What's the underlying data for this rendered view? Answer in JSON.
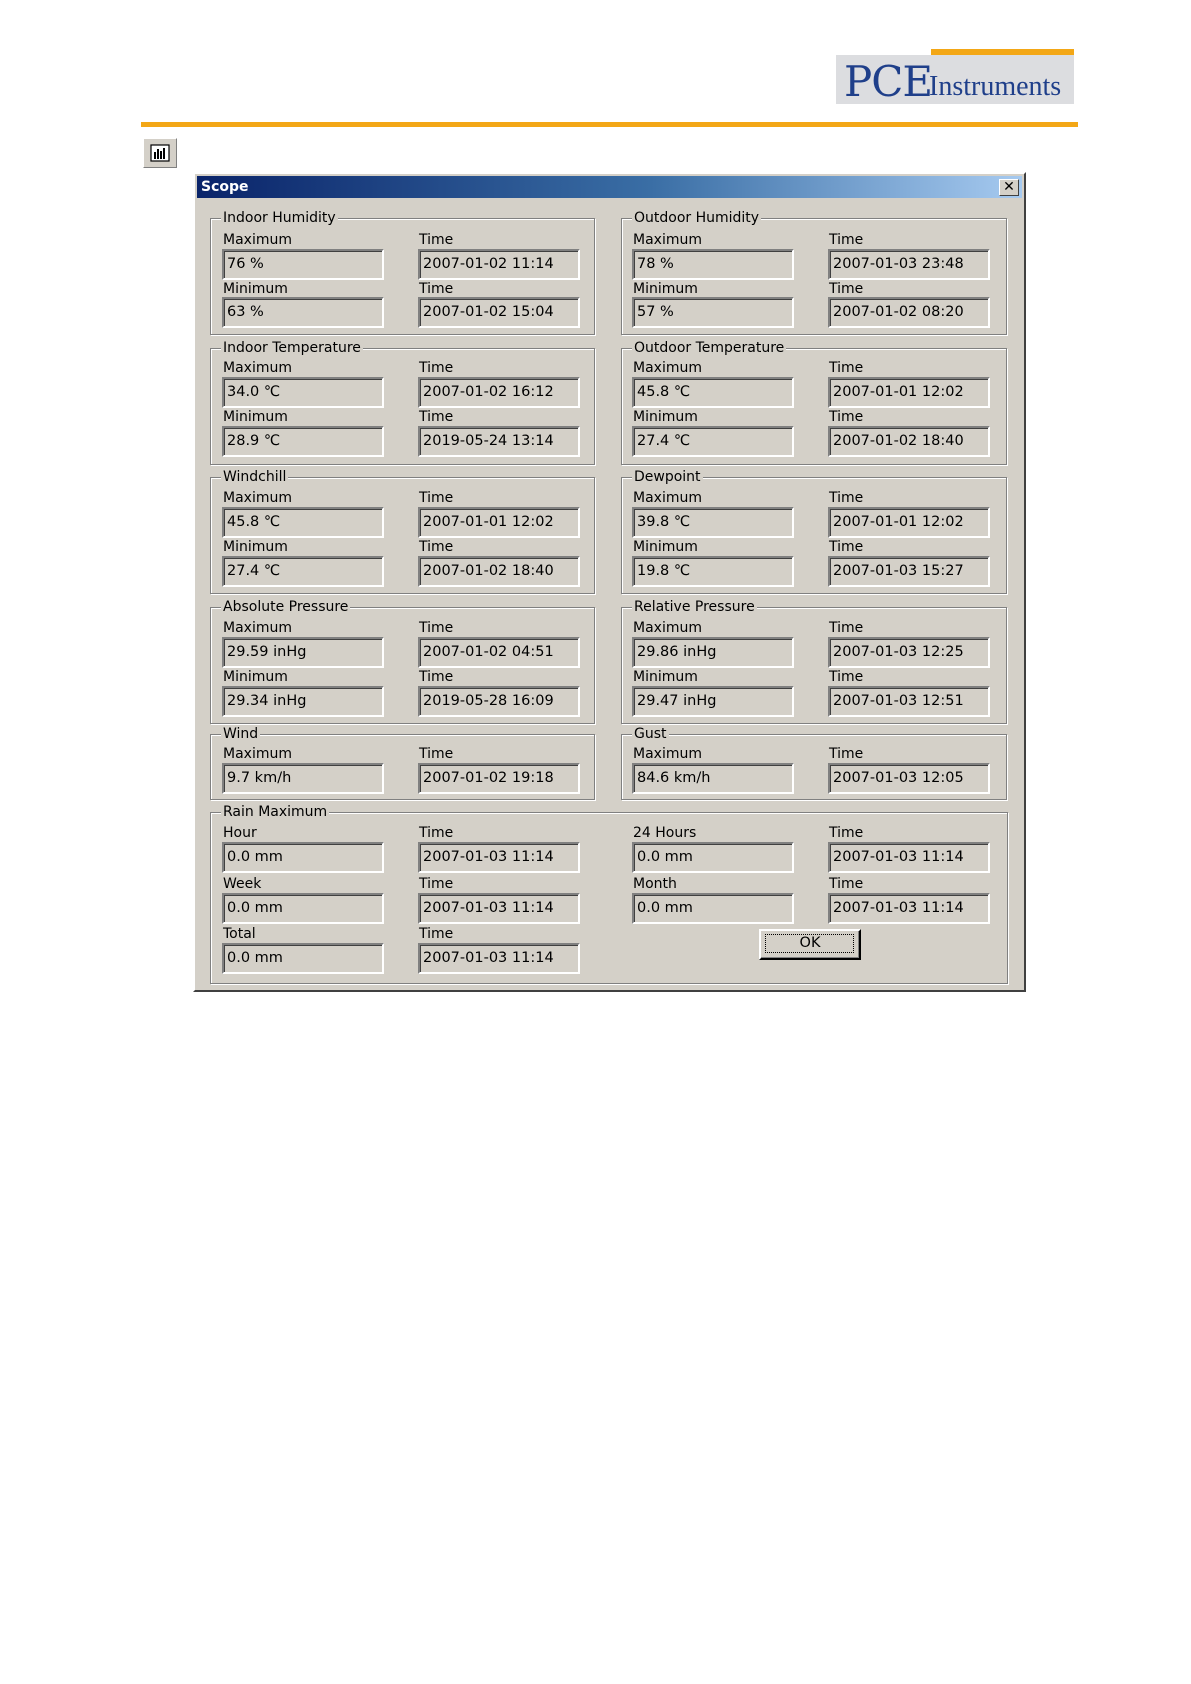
{
  "brand": {
    "logo_text_pce": "PCE",
    "logo_text_instruments": "Instruments",
    "accent_color": "#f3a716",
    "logo_color": "#1f3f8a"
  },
  "toolbar": {
    "icon": "chart-icon"
  },
  "dialog": {
    "title": "Scope",
    "ok_label": "OK",
    "groups": {
      "indoor_humidity": {
        "title": "Indoor Humidity",
        "max_label": "Maximum",
        "max_value": "76 %",
        "max_time_label": "Time",
        "max_time": "2007-01-02 11:14",
        "min_label": "Minimum",
        "min_value": "63 %",
        "min_time_label": "Time",
        "min_time": "2007-01-02 15:04"
      },
      "outdoor_humidity": {
        "title": "Outdoor Humidity",
        "max_label": "Maximum",
        "max_value": "78 %",
        "max_time_label": "Time",
        "max_time": "2007-01-03 23:48",
        "min_label": "Minimum",
        "min_value": "57 %",
        "min_time_label": "Time",
        "min_time": "2007-01-02 08:20"
      },
      "indoor_temperature": {
        "title": "Indoor Temperature",
        "max_label": "Maximum",
        "max_value": "34.0 ℃",
        "max_time_label": "Time",
        "max_time": "2007-01-02 16:12",
        "min_label": "Minimum",
        "min_value": "28.9 ℃",
        "min_time_label": "Time",
        "min_time": "2019-05-24 13:14"
      },
      "outdoor_temperature": {
        "title": "Outdoor Temperature",
        "max_label": "Maximum",
        "max_value": "45.8 ℃",
        "max_time_label": "Time",
        "max_time": "2007-01-01 12:02",
        "min_label": "Minimum",
        "min_value": "27.4 ℃",
        "min_time_label": "Time",
        "min_time": "2007-01-02 18:40"
      },
      "windchill": {
        "title": "Windchill",
        "max_label": "Maximum",
        "max_value": "45.8 ℃",
        "max_time_label": "Time",
        "max_time": "2007-01-01 12:02",
        "min_label": "Minimum",
        "min_value": "27.4 ℃",
        "min_time_label": "Time",
        "min_time": "2007-01-02 18:40"
      },
      "dewpoint": {
        "title": "Dewpoint",
        "max_label": "Maximum",
        "max_value": "39.8 ℃",
        "max_time_label": "Time",
        "max_time": "2007-01-01 12:02",
        "min_label": "Minimum",
        "min_value": "19.8 ℃",
        "min_time_label": "Time",
        "min_time": "2007-01-03 15:27"
      },
      "absolute_pressure": {
        "title": "Absolute Pressure",
        "max_label": "Maximum",
        "max_value": "29.59 inHg",
        "max_time_label": "Time",
        "max_time": "2007-01-02 04:51",
        "min_label": "Minimum",
        "min_value": "29.34 inHg",
        "min_time_label": "Time",
        "min_time": "2019-05-28 16:09"
      },
      "relative_pressure": {
        "title": "Relative Pressure",
        "max_label": "Maximum",
        "max_value": "29.86 inHg",
        "max_time_label": "Time",
        "max_time": "2007-01-03 12:25",
        "min_label": "Minimum",
        "min_value": "29.47 inHg",
        "min_time_label": "Time",
        "min_time": "2007-01-03 12:51"
      },
      "wind": {
        "title": "Wind",
        "max_label": "Maximum",
        "max_value": "9.7 km/h",
        "max_time_label": "Time",
        "max_time": "2007-01-02 19:18"
      },
      "gust": {
        "title": "Gust",
        "max_label": "Maximum",
        "max_value": "84.6 km/h",
        "max_time_label": "Time",
        "max_time": "2007-01-03 12:05"
      },
      "rain": {
        "title": "Rain Maximum",
        "hour_label": "Hour",
        "hour_value": "0.0 mm",
        "hour_time_label": "Time",
        "hour_time": "2007-01-03 11:14",
        "day_label": "24 Hours",
        "day_value": "0.0 mm",
        "day_time_label": "Time",
        "day_time": "2007-01-03 11:14",
        "week_label": "Week",
        "week_value": "0.0 mm",
        "week_time_label": "Time",
        "week_time": "2007-01-03 11:14",
        "month_label": "Month",
        "month_value": "0.0 mm",
        "month_time_label": "Time",
        "month_time": "2007-01-03 11:14",
        "total_label": "Total",
        "total_value": "0.0 mm",
        "total_time_label": "Time",
        "total_time": "2007-01-03 11:14"
      }
    }
  }
}
